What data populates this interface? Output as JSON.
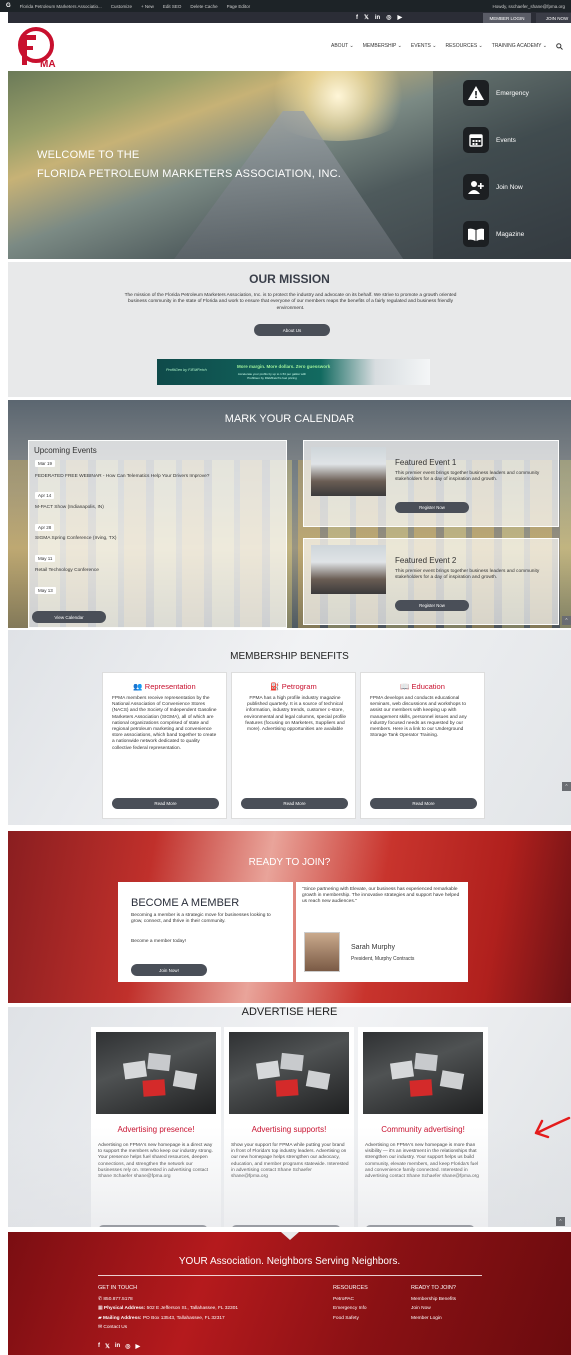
{
  "admin_bar": {
    "items": [
      "Florida Petroleum Marketers Associatio...",
      "Customize",
      "+ New",
      "Edit SEO",
      "Delete Cache",
      "Page Editor"
    ],
    "greeting": "Howdy, sschaefer_shane@fpma.org"
  },
  "util_bar": {
    "social_icons": [
      "facebook-icon",
      "x-icon",
      "linkedin-icon",
      "instagram-icon",
      "youtube-icon"
    ],
    "member_login": "MEMBER LOGIN",
    "join_now": "JOIN NOW"
  },
  "header": {
    "logo_text": "MA",
    "nav": [
      "ABOUT",
      "MEMBERSHIP",
      "EVENTS",
      "RESOURCES",
      "TRAINING ACADEMY"
    ]
  },
  "hero": {
    "line1": "WELCOME TO THE",
    "line2": "FLORIDA PETROLEUM MARKETERS ASSOCIATION, INC.",
    "quick_links": [
      {
        "label": "Emergency",
        "icon": "warning-icon"
      },
      {
        "label": "Events",
        "icon": "calendar-icon"
      },
      {
        "label": "Join Now",
        "icon": "add-user-icon"
      },
      {
        "label": "Magazine",
        "icon": "book-icon"
      }
    ]
  },
  "mission": {
    "title": "OUR MISSION",
    "text": "The mission of the Florida Petroleum Marketers Association, Inc. is to protect the industry and advocate on its behalf. We strive to promote a growth oriented business community in the state of Florida and work to ensure that everyone of our members reaps the benefits of a fairly regulated and business friendly environment.",
    "button": "About Us",
    "banner": {
      "brand": "ProfitGen by FIEMFetch",
      "headline": "More margin. More dollars. Zero guesswork",
      "sub": "Accelerate your profits by up to 1.5¢ per gallon with ProfitGen by FIEMFetch's fuel pricing"
    }
  },
  "calendar": {
    "title": "MARK YOUR CALENDAR",
    "heading": "Upcoming Events",
    "events": [
      {
        "date": "Mar 19",
        "name": "FEDERATED FREE WEBINAR - How Can Telematics Help Your Drivers Improve?"
      },
      {
        "date": "Apr 14",
        "name": "M-PACT Show (Indianapolis, IN)"
      },
      {
        "date": "Apr 28",
        "name": "SIGMA Spring Conference (Irving, TX)"
      },
      {
        "date": "May 11",
        "name": "Retail Technology Conference"
      },
      {
        "date": "May 13",
        "name": ""
      }
    ],
    "view_button": "View Calendar",
    "featured": [
      {
        "title": "Featured Event 1",
        "text": "This premier event brings together business leaders and community stakeholders for a day of inspiration and growth.",
        "button": "Register Now"
      },
      {
        "title": "Featured Event 2",
        "text": "This premier event brings together business leaders and community stakeholders for a day of inspiration and growth.",
        "button": "Register Now"
      }
    ]
  },
  "benefits": {
    "title": "MEMBERSHIP BENEFITS",
    "cards": [
      {
        "title": "Representation",
        "icon": "people-icon",
        "text": "FPMA members receive representation by the National Association of Convenience Stores (NACS) and the Society of Independent Gasoline Marketers Association (SIGMA), all of which are national organizations comprised of state and regional petroleum marketing and convenience store associations, which band together to create a nationwide network dedicated to quality collective federal representation.",
        "button": "Read More"
      },
      {
        "title": "Petrogram",
        "icon": "fuel-pump-icon",
        "text": "FPMA has a high profile industry magazine published quarterly. It is a source of technical information, industry trends, customer c-store, environmental and legal columns, special profile features (focusing on Marketers, Suppliers and more). Advertising opportunities are available",
        "button": "Read More"
      },
      {
        "title": "Education",
        "icon": "book-icon",
        "text": "FPMA develops and conducts educational seminars, web discussions and workshops to assist our members with keeping up with management skills, personnel issues and any industry focused needs as requested by our members. Here is a link to our Underground Storage Tank Operator Training.",
        "button": "Read More"
      }
    ]
  },
  "join": {
    "title": "READY TO JOIN?",
    "heading": "BECOME A MEMBER",
    "text": "Becoming a member is a strategic move for businesses looking to grow, connect, and thrive in their community.",
    "text2": "Become a member today!",
    "button": "Join Now!",
    "quote": "\"Since partnering with Elevate, our business has experienced remarkable growth in membership. The innovative strategies and support have helped us reach new audiences.\"",
    "person": "Sarah Murphy",
    "role": "President, Murphy Contracts"
  },
  "advertise": {
    "title": "ADVERTISE HERE",
    "cards": [
      {
        "title": "Advertising presence!",
        "text": "Advertising on FPMA's new homepage is a direct way to support the members who keep our industry strong. Your presence helps fuel shared resources, deepen connections, and strengthen the network our businesses rely on. Interested in advertising contact Shane Schaefer shane@fpma.org"
      },
      {
        "title": "Advertising supports!",
        "text": "Show your support for FPMA while putting your brand in front of Florida's top industry leaders. Advertising on our new homepage helps strengthen our advocacy, education, and member programs statewide. Interested in advertising contact Shane Schaefer shane@fpma.org"
      },
      {
        "title": "Community advertising!",
        "text": "Advertising on FPMA's new homepage is more than visibility — it's an investment in the relationships that strengthen our industry. Your support helps us build community, elevate members, and keep Florida's fuel and convenience family connected. Interested in advertising contact Shane Schaefer shane@fpma.org"
      }
    ]
  },
  "footer": {
    "tagline": "YOUR Association. Neighbors Serving Neighbors.",
    "get_in_touch": {
      "heading": "GET IN TOUCH",
      "phone": "850.877.5178",
      "physical_label": "Physical Address:",
      "physical": "502 E Jefferson St., Tallahassee, FL 32301",
      "mailing_label": "Mailing Address:",
      "mailing": "PO Box 13543, Tallahassee, FL 32317",
      "contact": "Contact Us"
    },
    "resources": {
      "heading": "RESOURCES",
      "items": [
        "PetroPAC",
        "Emergency Info",
        "Food Safety"
      ]
    },
    "ready": {
      "heading": "READY TO JOIN?",
      "items": [
        "Membership Benefits",
        "Join Now",
        "Member Login"
      ]
    }
  },
  "colors": {
    "brand_red": "#c8102e",
    "dark": "#2b2d36",
    "button": "#4a4f58"
  }
}
